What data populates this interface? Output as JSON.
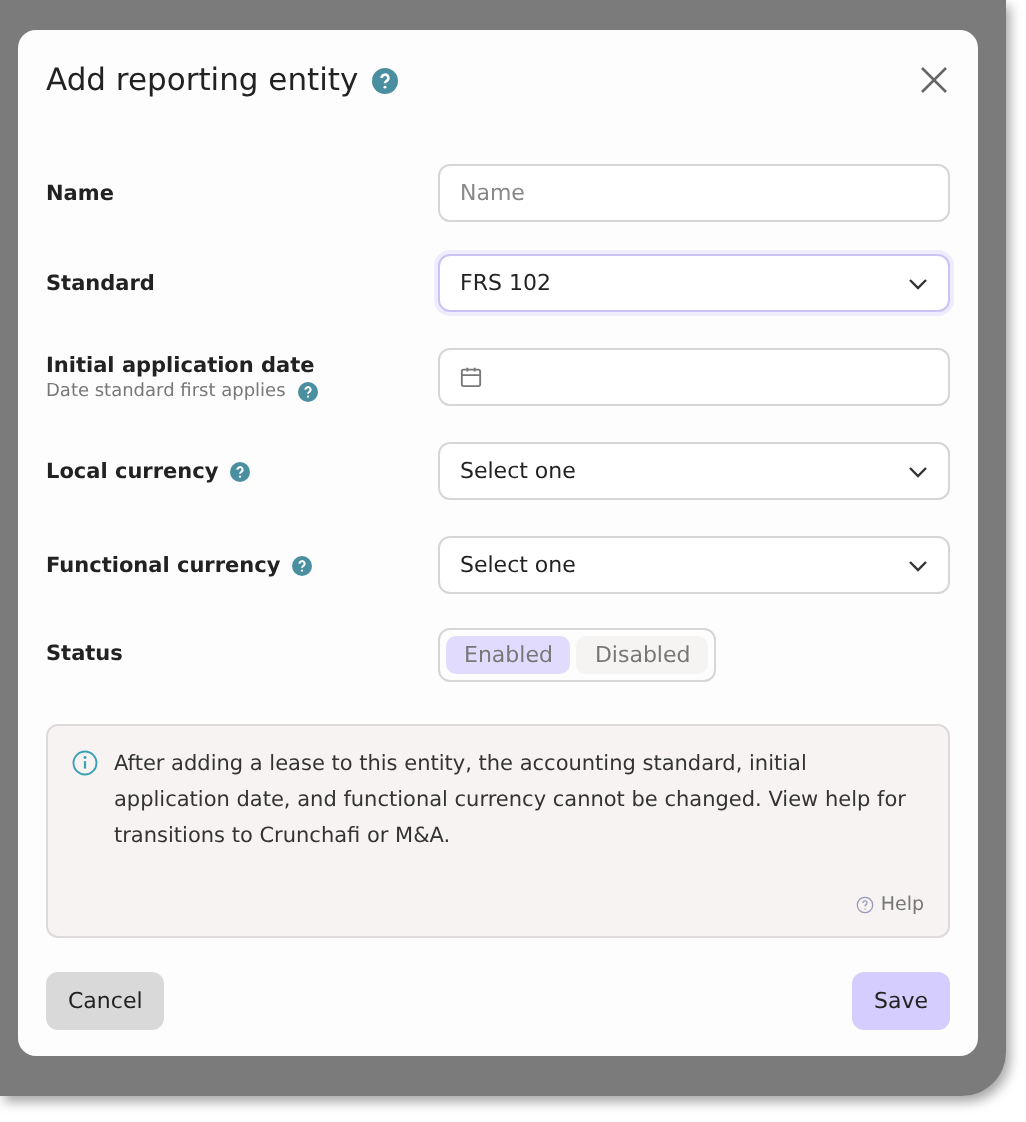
{
  "dialog": {
    "title": "Add reporting entity",
    "title_help": true
  },
  "fields": [
    {
      "kind": "text",
      "label": "Name",
      "placeholder": "Name",
      "help": false
    },
    {
      "kind": "select",
      "label": "Standard",
      "value": "FRS 102",
      "help": false,
      "focused": true
    },
    {
      "kind": "date",
      "label": "Initial application date",
      "hint": "Date standard first applies",
      "help": true
    },
    {
      "kind": "select",
      "label": "Local currency",
      "value": "Select one",
      "help": true,
      "focused": false
    },
    {
      "kind": "select",
      "label": "Functional currency",
      "value": "Select one",
      "help": true,
      "focused": false
    },
    {
      "kind": "toggle",
      "label": "Status",
      "help": false,
      "options": [
        {
          "label": "Enabled",
          "selected": true
        },
        {
          "label": "Disabled",
          "selected": false
        }
      ]
    }
  ],
  "notice": {
    "text": "After adding a lease to this entity, the accounting standard, initial application date, and functional currency cannot be changed. View help for transitions to Crunchafi or M&A.",
    "link": "Help"
  },
  "buttons": {
    "cancel": "Cancel",
    "save": "Save"
  }
}
